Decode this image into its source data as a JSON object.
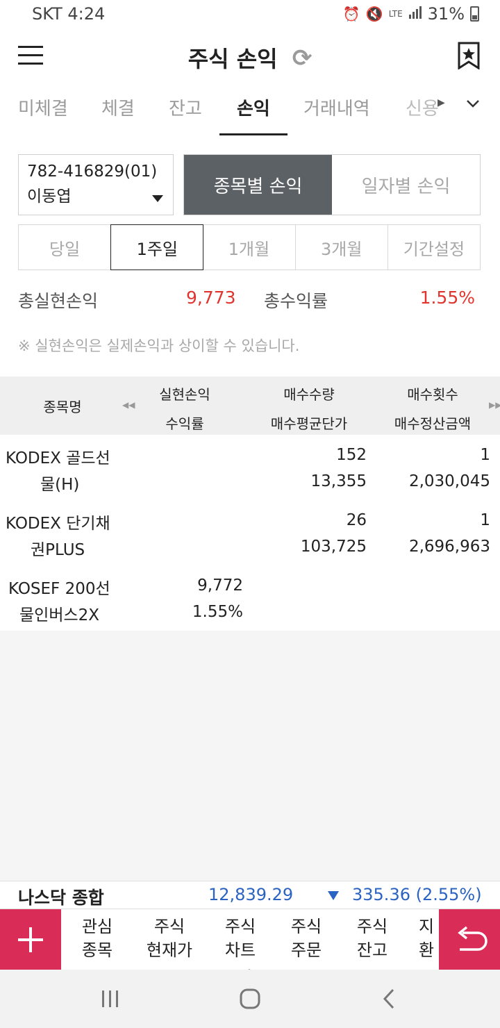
{
  "status_bar": {
    "carrier_time": "SKT 4:24",
    "network": "LTE",
    "battery": "31%"
  },
  "header": {
    "title": "주식 손익"
  },
  "tabs": [
    {
      "label": "미체결"
    },
    {
      "label": "체결"
    },
    {
      "label": "잔고"
    },
    {
      "label": "손익"
    },
    {
      "label": "거래내역"
    },
    {
      "label": "신용"
    }
  ],
  "account": {
    "number": "782-416829(01)",
    "name": "이동엽"
  },
  "mode": {
    "by_item": "종목별 손익",
    "by_date": "일자별 손익"
  },
  "periods": [
    "당일",
    "1주일",
    "1개월",
    "3개월",
    "기간설정"
  ],
  "summary": {
    "realized_label": "총실현손익",
    "realized_value": "9,773",
    "return_label": "총수익률",
    "return_value": "1.55%"
  },
  "note": "※ 실현손익은 실제손익과 상이할 수 있습니다.",
  "table": {
    "headers": {
      "name": "종목명",
      "realized": "실현손익",
      "rate": "수익률",
      "buy_qty": "매수수량",
      "buy_avg": "매수평균단가",
      "buy_count": "매수횟수",
      "buy_amount": "매수정산금액"
    },
    "rows": [
      {
        "name1": "KODEX 골드선",
        "name2": "물(H)",
        "realized": "",
        "rate": "",
        "buy_qty": "152",
        "buy_avg": "13,355",
        "buy_count": "1",
        "buy_amount": "2,030,045"
      },
      {
        "name1": "KODEX 단기채",
        "name2": "권PLUS",
        "realized": "",
        "rate": "",
        "buy_qty": "26",
        "buy_avg": "103,725",
        "buy_count": "1",
        "buy_amount": "2,696,963"
      },
      {
        "name1": "KOSEF 200선",
        "name2": "물인버스2X",
        "realized": "9,772",
        "rate": "1.55%",
        "buy_qty": "",
        "buy_avg": "",
        "buy_count": "",
        "buy_amount": ""
      }
    ]
  },
  "ticker": {
    "name": "나스닥 종합",
    "value": "12,839.29",
    "change": "335.36 (2.55%)"
  },
  "bottom_nav": [
    {
      "line1": "관심",
      "line2": "종목"
    },
    {
      "line1": "주식",
      "line2": "현재가"
    },
    {
      "line1": "주식",
      "line2": "차트"
    },
    {
      "line1": "주식",
      "line2": "주문"
    },
    {
      "line1": "주식",
      "line2": "잔고"
    },
    {
      "line1": "지",
      "line2": "환"
    }
  ],
  "colors": {
    "accent_red": "#e0352f",
    "accent_blue": "#2a63c2",
    "brand_pink": "#d92d58",
    "segment_dark": "#5c6166"
  }
}
